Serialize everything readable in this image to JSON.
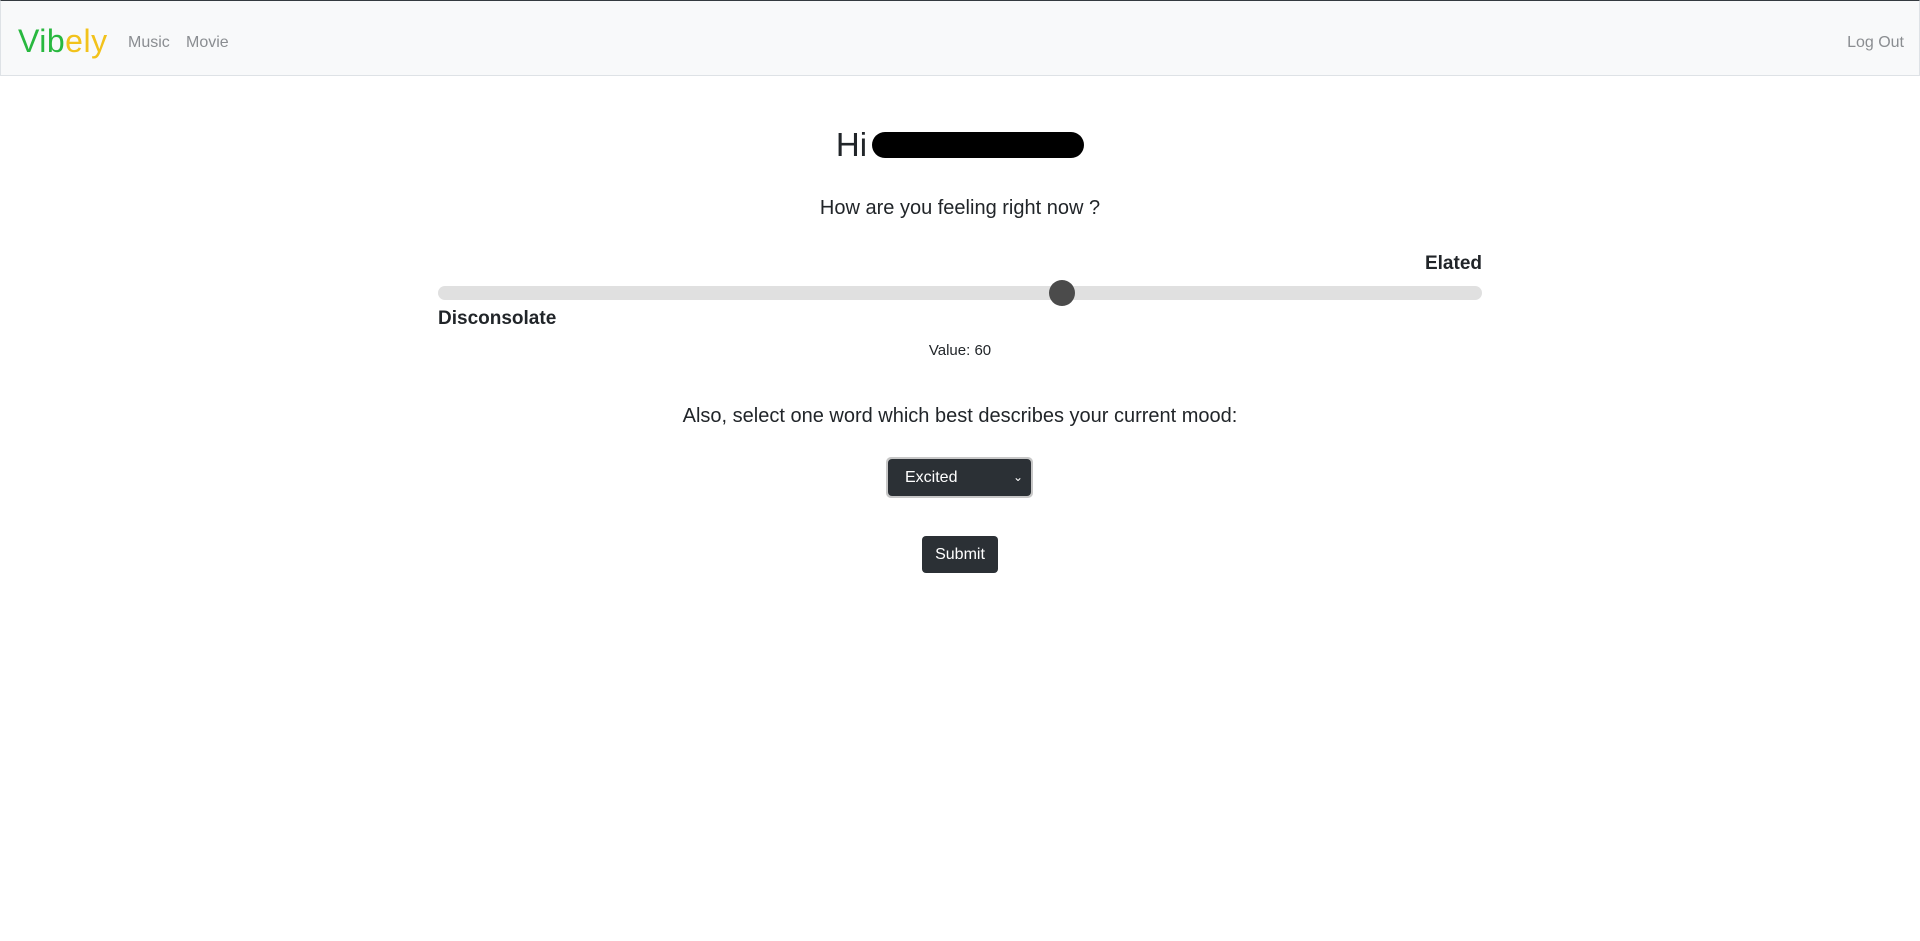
{
  "navbar": {
    "brand": {
      "part1": "Vib",
      "part2": "ely",
      "color1": "#28b83f",
      "color2": "#f2c21b"
    },
    "links": [
      "Music",
      "Movie"
    ],
    "logout": "Log Out"
  },
  "greeting": {
    "prefix": "Hi"
  },
  "question": "How are you feeling right now ?",
  "slider": {
    "max_label": "Elated",
    "min_label": "Disconsolate",
    "value": 60,
    "min": 0,
    "max": 100,
    "value_text": "Value: 60"
  },
  "mood": {
    "prompt": "Also, select one word which best describes your current mood:",
    "selected": "Excited"
  },
  "submit_label": "Submit"
}
